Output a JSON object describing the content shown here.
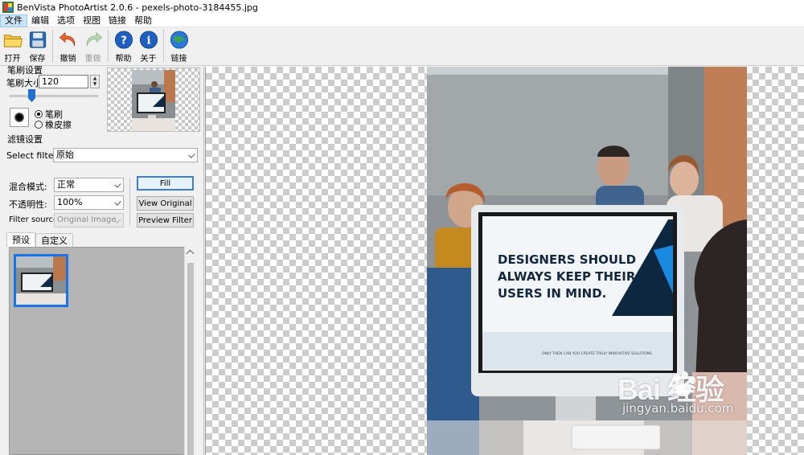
{
  "window": {
    "title": "BenVista PhotoArtist 2.0.6 - pexels-photo-3184455.jpg"
  },
  "menu": {
    "items": [
      "文件",
      "编辑",
      "选项",
      "视图",
      "链接",
      "帮助"
    ]
  },
  "toolbar": {
    "open": "打开",
    "save": "保存",
    "undo": "撤销",
    "redo": "重做",
    "help": "帮助",
    "about": "关于",
    "link": "链接"
  },
  "brush": {
    "group_title": "笔刷设置",
    "size_label": "笔刷大小:",
    "size_value": "120",
    "size_level": 0.25,
    "mode_brush": "笔刷",
    "mode_eraser": "橡皮擦",
    "selected_mode": "笔刷"
  },
  "filter": {
    "group_title": "滤镜设置",
    "select_label": "Select filter:",
    "select_value": "原始",
    "blend_label": "混合模式:",
    "blend_value": "正常",
    "opacity_label": "不透明性:",
    "opacity_value": "100%",
    "source_label": "Filter source:",
    "source_value": "Original Image",
    "fill_button": "Fill",
    "view_original_button": "View Original",
    "preview_filter_button": "Preview Filter"
  },
  "tabs": {
    "preset": "预设",
    "custom": "自定义",
    "active": "预设"
  },
  "photo": {
    "screen_headline_1": "DESIGNERS SHOULD",
    "screen_headline_2": "ALWAYS KEEP THEIR",
    "screen_headline_3": "USERS IN MIND.",
    "screen_subline": "ONLY THEN CAN YOU CREATE TRULY INNOVATIVE SOLUTIONS"
  },
  "watermark": {
    "brand": "Bai  经验",
    "url": "jingyan.baidu.com"
  },
  "colors": {
    "accent": "#1a73e8",
    "canvas_checker": "#cccccc",
    "panel": "#f0f0f0"
  }
}
